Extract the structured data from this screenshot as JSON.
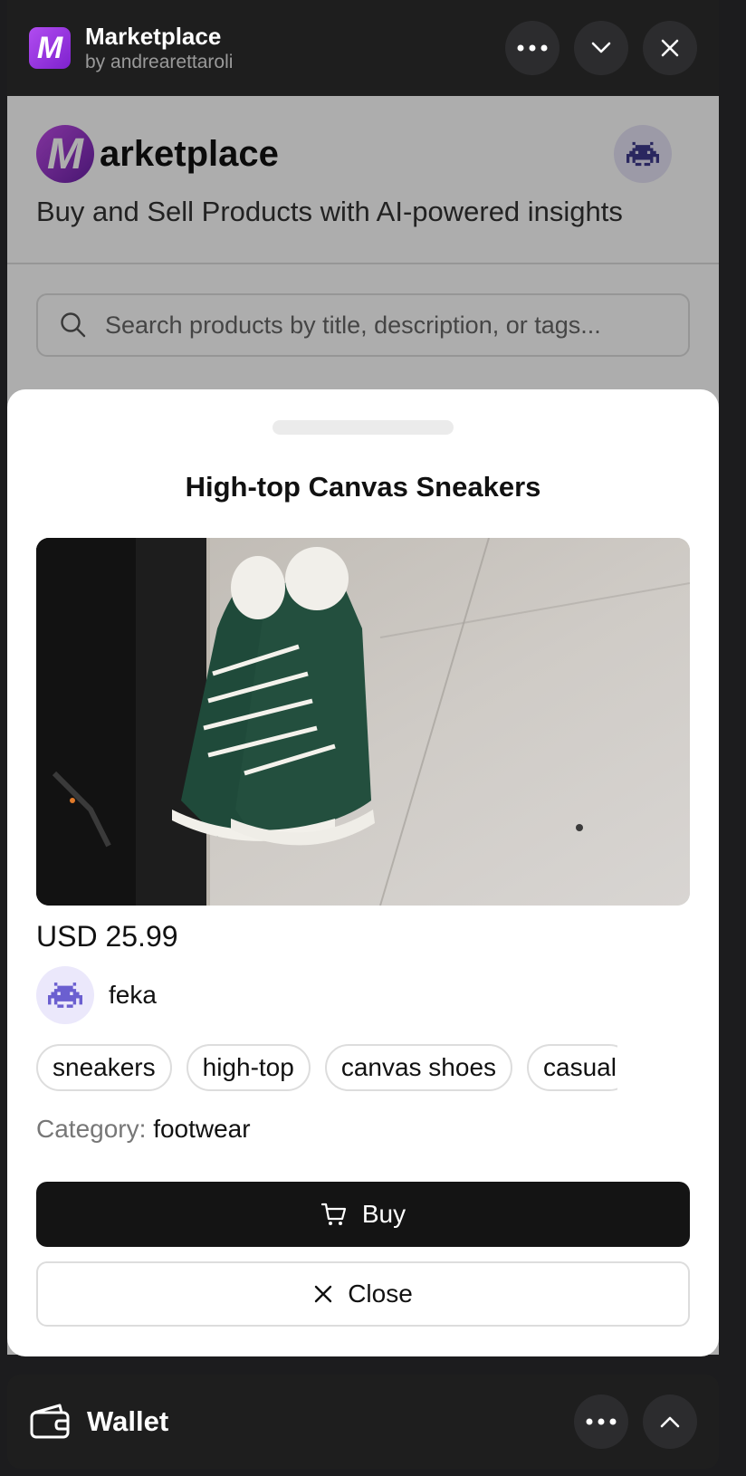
{
  "app": {
    "title": "Marketplace",
    "author": "by andrearettaroli",
    "icon_letter": "M"
  },
  "page": {
    "logo_letter": "M",
    "logo_text": "arketplace",
    "tagline": "Buy and Sell Products with AI-powered insights",
    "search_placeholder": "Search products by title, description, or tags..."
  },
  "product": {
    "title": "High-top Canvas Sneakers",
    "price": "USD 25.99",
    "seller": "feka",
    "tags": [
      "sneakers",
      "high-top",
      "canvas shoes",
      "casual"
    ],
    "category_label": "Category:",
    "category_value": "footwear"
  },
  "actions": {
    "buy_label": "Buy",
    "close_label": "Close"
  },
  "wallet": {
    "title": "Wallet"
  },
  "colors": {
    "accent": "#9333ea",
    "dark": "#141414",
    "avatar_bg": "#ebe8fb"
  }
}
